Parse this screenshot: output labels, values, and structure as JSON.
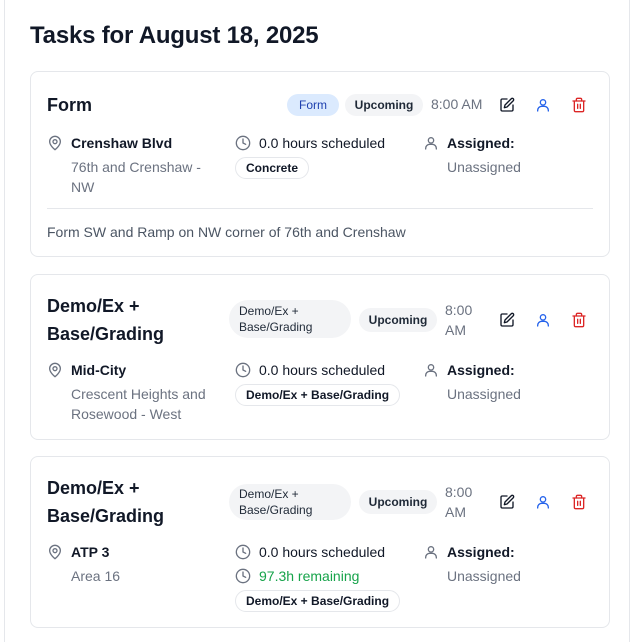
{
  "page": {
    "title": "Tasks for August 18, 2025"
  },
  "colors": {
    "accent": "#2563eb",
    "danger": "#dc2626",
    "success": "#16a34a",
    "muted": "#6b7280"
  },
  "tasks": [
    {
      "title": "Form",
      "type_badge": "Form",
      "status": "Upcoming",
      "time": "8:00 AM",
      "location_name": "Crenshaw Blvd",
      "location_detail": "76th and Crenshaw - NW",
      "hours": "0.0 hours scheduled",
      "remaining": "",
      "tag": "Concrete",
      "assigned_label": "Assigned:",
      "assigned_value": "Unassigned",
      "note": "Form SW and Ramp on NW corner of 76th and Crenshaw"
    },
    {
      "title": "Demo/Ex + Base/Grading",
      "type_badge": "Demo/Ex + Base/Grading",
      "status": "Upcoming",
      "time": "8:00 AM",
      "location_name": "Mid-City",
      "location_detail": "Crescent Heights and Rosewood - West",
      "hours": "0.0 hours scheduled",
      "remaining": "",
      "tag": "Demo/Ex + Base/Grading",
      "assigned_label": "Assigned:",
      "assigned_value": "Unassigned",
      "note": ""
    },
    {
      "title": "Demo/Ex + Base/Grading",
      "type_badge": "Demo/Ex + Base/Grading",
      "status": "Upcoming",
      "time": "8:00 AM",
      "location_name": "ATP 3",
      "location_detail": "Area 16",
      "hours": "0.0 hours scheduled",
      "remaining": "97.3h remaining",
      "tag": "Demo/Ex + Base/Grading",
      "assigned_label": "Assigned:",
      "assigned_value": "Unassigned",
      "note": ""
    }
  ]
}
